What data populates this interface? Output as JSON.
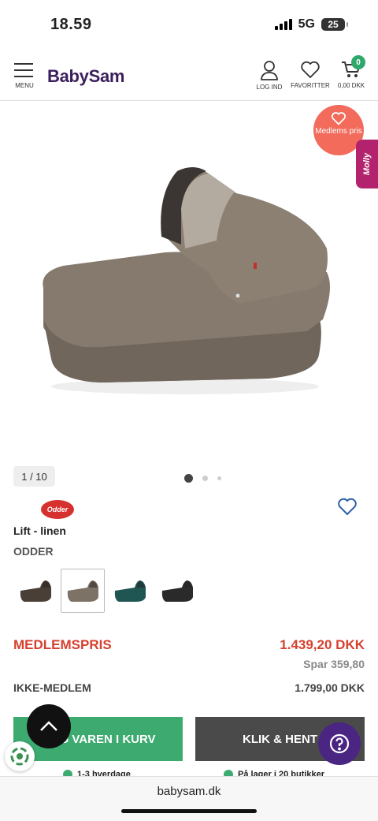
{
  "status": {
    "time": "18.59",
    "network": "5G",
    "battery": "25"
  },
  "header": {
    "menu_label": "MENU",
    "logo": "BabySam",
    "login_label": "LOG IND",
    "favorites_label": "FAVORITTER",
    "cart_label": "0,00 DKK",
    "cart_count": "0"
  },
  "gallery": {
    "member_badge": "Medlems pris",
    "molly_tab": "Molly",
    "counter": "1 / 10",
    "dots": 3,
    "active_dot": 0
  },
  "product": {
    "brand_logo": "Odder",
    "name": "Lift - linen",
    "brand": "ODDER",
    "variants": [
      {
        "name": "dark-brown",
        "color": "#4a3f36",
        "selected": false
      },
      {
        "name": "linen",
        "color": "#7d7266",
        "selected": true
      },
      {
        "name": "petrol",
        "color": "#1f5552",
        "selected": false
      },
      {
        "name": "black",
        "color": "#2a2a2a",
        "selected": false
      }
    ]
  },
  "pricing": {
    "member_label": "MEDLEMSPRIS",
    "member_price": "1.439,20 DKK",
    "savings": "Spar 359,80",
    "nonmember_label": "IKKE-MEDLEM",
    "nonmember_price": "1.799,00 DKK"
  },
  "actions": {
    "add_to_cart": "LÆG VAREN I KURV",
    "click_collect": "KLIK & HENT"
  },
  "perks": [
    "1-3 hverdage",
    "På lager i 20 butikker"
  ],
  "browser": {
    "url": "babysam.dk"
  },
  "colors": {
    "accent_green": "#3dab70",
    "price_red": "#d6402f",
    "brand_purple": "#3b1f5c"
  }
}
